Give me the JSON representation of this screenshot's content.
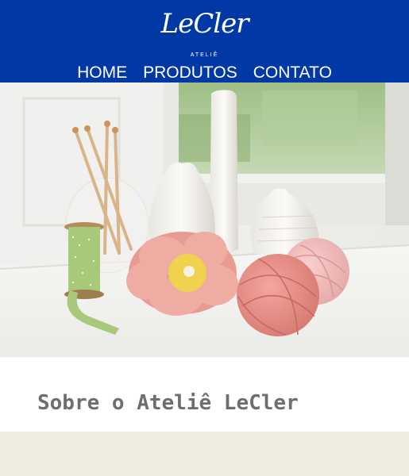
{
  "brand": {
    "logo_text": "LeCler",
    "tagline": "ATELIÊ"
  },
  "nav": {
    "items": [
      {
        "label": "HOME"
      },
      {
        "label": "PRODUTOS"
      },
      {
        "label": "CONTATO"
      }
    ]
  },
  "about": {
    "title": "Sobre o Ateliê LeCler"
  },
  "colors": {
    "header_bg": "#0039a6",
    "nav_text": "#ffffff",
    "about_title": "#6e6e6e",
    "footer_band": "#eeecdf"
  },
  "icons": [
    "crochet-flower-image",
    "yarn-ball-image",
    "ribbon-spool-image",
    "bobbin-image",
    "vase-image"
  ]
}
